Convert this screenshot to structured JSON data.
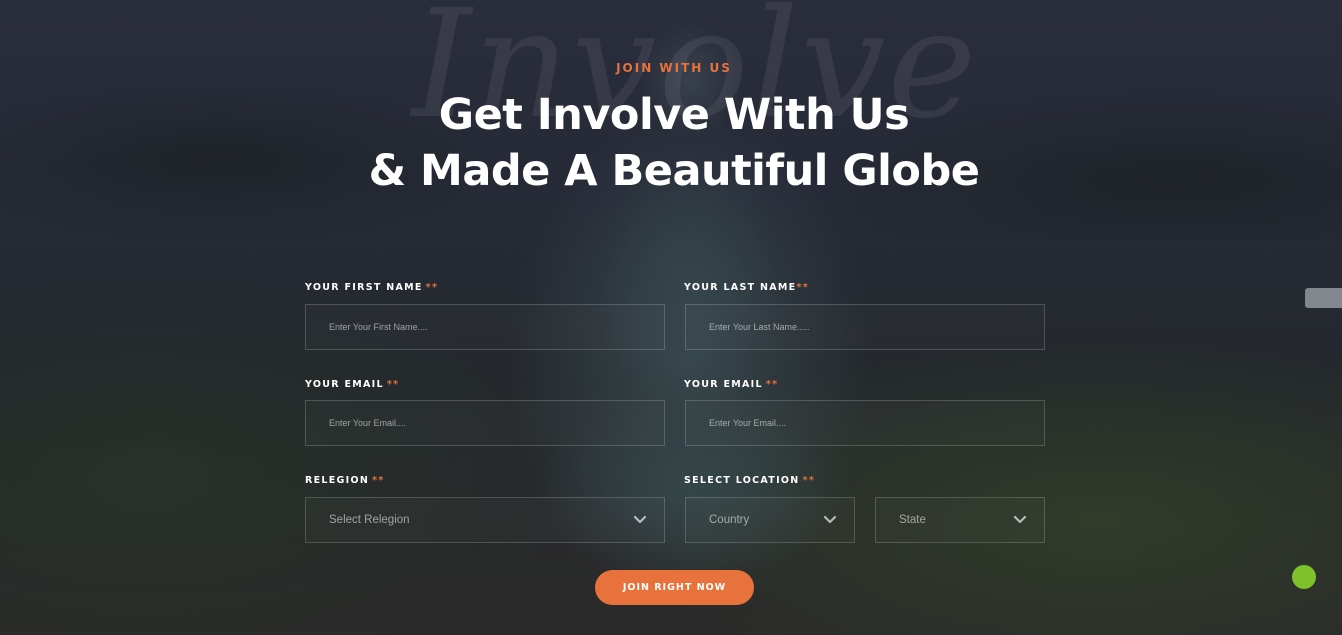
{
  "watermark": "Involve",
  "header": {
    "eyebrow": "JOIN WITH US",
    "title_line1": "Get Involve With Us",
    "title_line2": "& Made A Beautiful Globe"
  },
  "form": {
    "required_mark": "**",
    "first_name": {
      "label": "YOUR FIRST NAME",
      "placeholder": "Enter Your First Name...."
    },
    "last_name": {
      "label": "YOUR LAST NAME",
      "placeholder": "Enter Your Last Name....."
    },
    "email_1": {
      "label": "YOUR EMAIL",
      "placeholder": "Enter Your Email...."
    },
    "email_2": {
      "label": "YOUR EMAIL",
      "placeholder": "Enter Your Email...."
    },
    "religion": {
      "label": "RELEGION",
      "value": "Select Relegion"
    },
    "location": {
      "label": "SELECT LOCATION",
      "country": "Country",
      "state": "State"
    },
    "submit_label": "JOIN RIGHT NOW"
  },
  "icons": {
    "dropdown": "chevron-down-icon",
    "chat": "green-dot"
  },
  "colors": {
    "accent": "#e8723b",
    "green": "#7ec12b"
  }
}
